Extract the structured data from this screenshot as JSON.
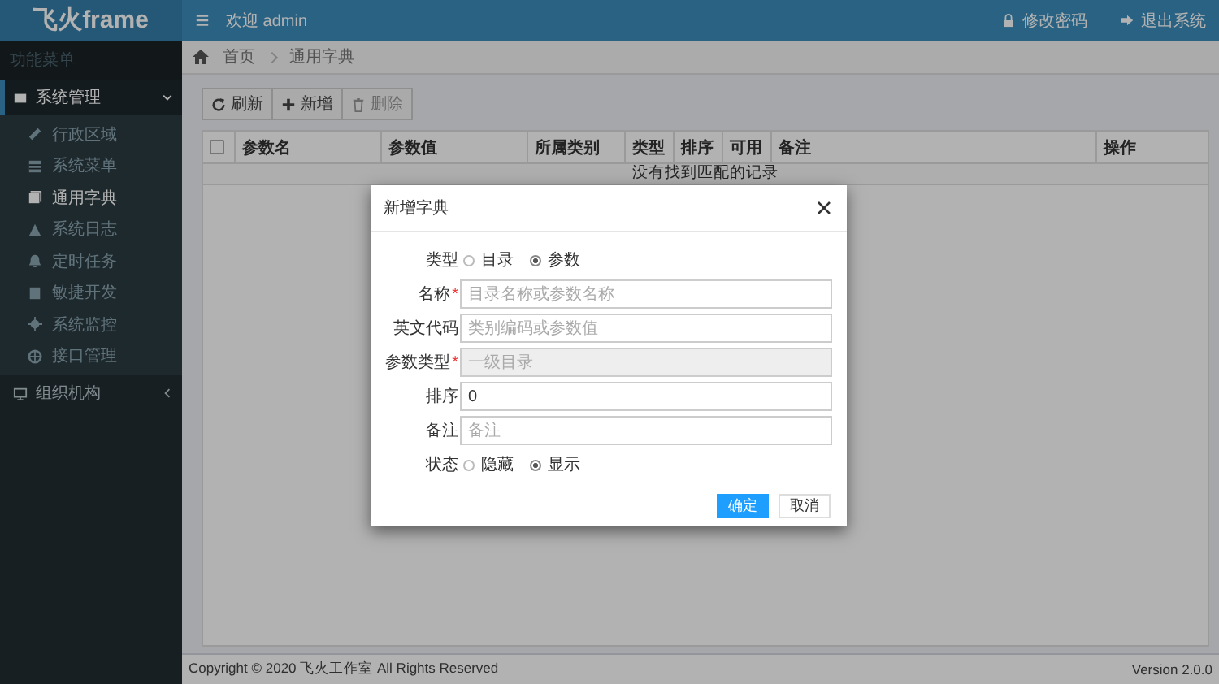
{
  "header": {
    "logo": "飞火frame",
    "welcome": "欢迎 admin",
    "links": [
      {
        "kind": "password",
        "label": "修改密码"
      },
      {
        "kind": "logout",
        "label": "退出系统"
      }
    ]
  },
  "sidebar": {
    "section_label": "功能菜单",
    "items": [
      {
        "label": "系统管理",
        "selected": true,
        "expanded": true,
        "children": [
          {
            "label": "行政区域",
            "selected": false
          },
          {
            "label": "系统菜单",
            "selected": false
          },
          {
            "label": "通用字典",
            "selected": true
          },
          {
            "label": "系统日志",
            "selected": false
          },
          {
            "label": "定时任务",
            "selected": false
          },
          {
            "label": "敏捷开发",
            "selected": false
          },
          {
            "label": "系统监控",
            "selected": false
          },
          {
            "label": "接口管理",
            "selected": false
          }
        ]
      },
      {
        "label": "组织机构",
        "selected": false,
        "expanded": false
      }
    ]
  },
  "breadcrumb": [
    "首页",
    "通用字典"
  ],
  "toolbar": [
    {
      "kind": "refresh",
      "label": "刷新"
    },
    {
      "kind": "add",
      "label": "新增"
    },
    {
      "kind": "delete",
      "label": "删除"
    }
  ],
  "table": {
    "select_all_checked": false,
    "columns": [
      "参数名",
      "参数值",
      "所属类别",
      "类型",
      "排序",
      "可用",
      "备注",
      "操作"
    ],
    "empty_message": "没有找到匹配的记录"
  },
  "modal": {
    "title": "新增字典",
    "required_mark": "*",
    "fields": [
      {
        "kind": "radio",
        "label": "类型",
        "options": [
          {
            "label": "目录",
            "selected": false
          },
          {
            "label": "参数",
            "selected": true
          }
        ]
      },
      {
        "kind": "text",
        "label": "名称",
        "required": true,
        "placeholder": "目录名称或参数名称"
      },
      {
        "kind": "text",
        "label": "英文代码",
        "required": false,
        "placeholder": "类别编码或参数值"
      },
      {
        "kind": "text",
        "label": "参数类型",
        "required": true,
        "disabled": true,
        "placeholder": "一级目录"
      },
      {
        "kind": "text",
        "label": "排序",
        "required": false,
        "value": "0"
      },
      {
        "kind": "text",
        "label": "备注",
        "required": false,
        "placeholder": "备注"
      },
      {
        "kind": "radio",
        "label": "状态",
        "options": [
          {
            "label": "隐藏",
            "selected": false
          },
          {
            "label": "显示",
            "selected": true
          }
        ]
      }
    ],
    "buttons": [
      {
        "kind": "primary",
        "label": "确定"
      },
      {
        "kind": "default",
        "label": "取消"
      }
    ]
  },
  "footer": {
    "copyright": "Copyright © 2020 飞火工作室 All Rights Reserved",
    "version": "Version 2.0.0"
  }
}
